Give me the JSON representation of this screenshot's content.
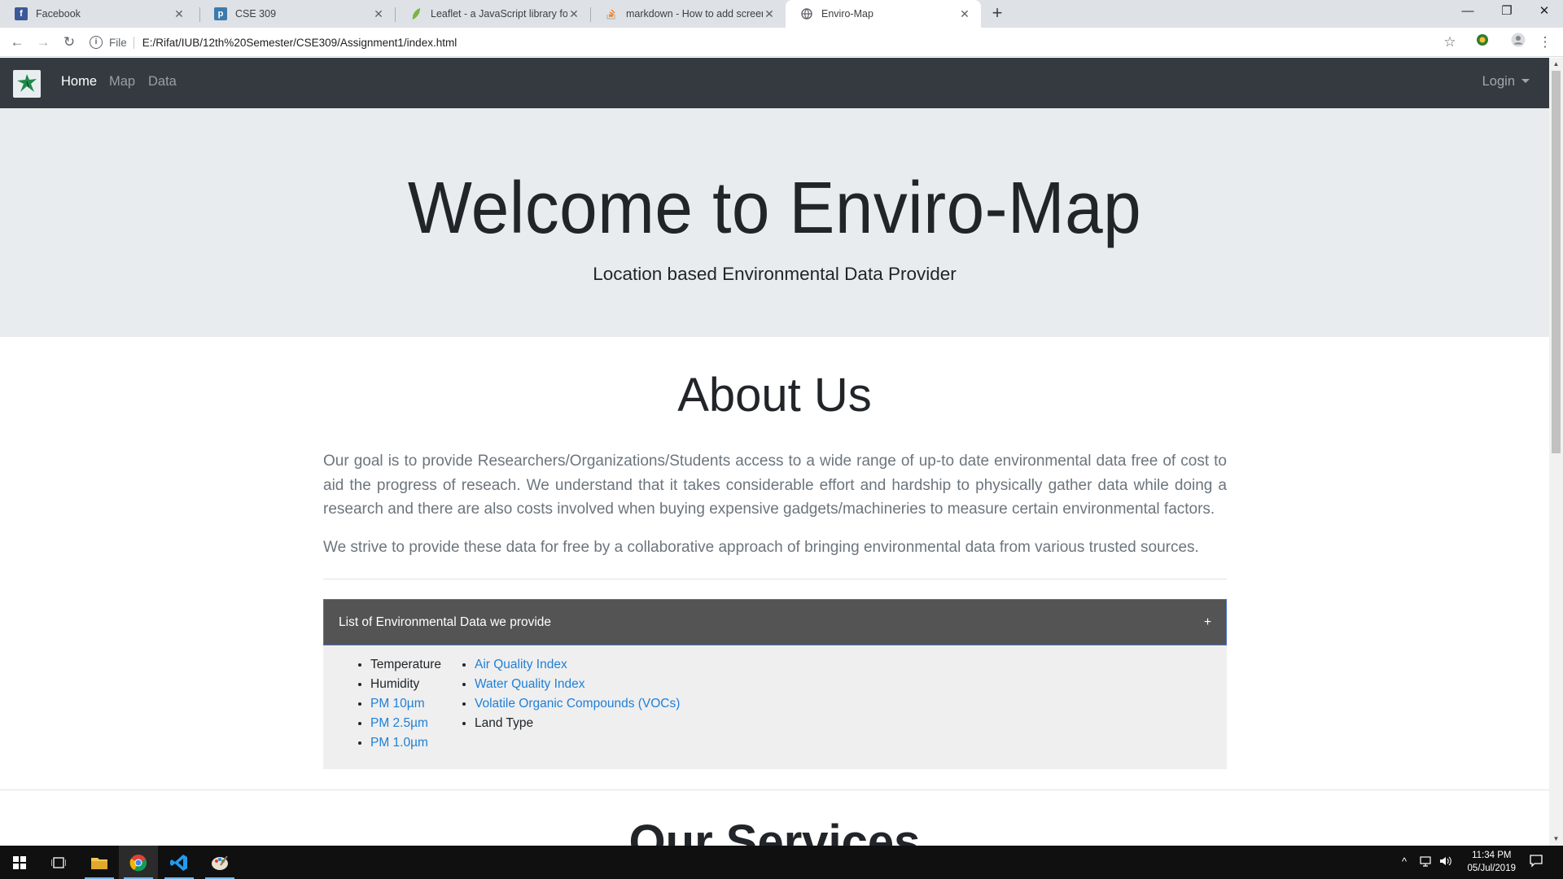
{
  "browser": {
    "tabs": [
      {
        "title": "Facebook",
        "icon": "facebook-icon",
        "active": false
      },
      {
        "title": "CSE 309",
        "icon": "piazza-icon",
        "active": false
      },
      {
        "title": "Leaflet - a JavaScript library for interactive maps",
        "icon": "leaflet-icon",
        "active": false
      },
      {
        "title": "markdown - How to add screenshots",
        "icon": "stackoverflow-icon",
        "active": false
      },
      {
        "title": "Enviro-Map",
        "icon": "globe-icon",
        "active": true
      }
    ],
    "address": {
      "scheme": "File",
      "url": "E:/Rifat/IUB/12th%20Semester/CSE309/Assignment1/index.html"
    }
  },
  "site": {
    "nav": {
      "links": [
        "Home",
        "Map",
        "Data"
      ],
      "active": "Home",
      "login": "Login"
    },
    "hero": {
      "title": "Welcome to Enviro-Map",
      "subtitle": "Location based Environmental Data Provider"
    },
    "about": {
      "title": "About Us",
      "paragraph1": "Our goal is to provide Researchers/Organizations/Students access to a wide range of up-to date environmental data free of cost to aid the progress of reseach. We understand that it takes considerable effort and hardship to physically gather data while doing a research and there are also costs involved when buying expensive gadgets/machineries to measure certain environmental factors.",
      "paragraph2": "We strive to provide these data for free by a collaborative approach of bringing environmental data from various trusted sources."
    },
    "accordion": {
      "header": "List of Environmental Data we provide",
      "toggle": "+",
      "list1": [
        {
          "text": "Temperature",
          "link": false
        },
        {
          "text": "Humidity",
          "link": false
        },
        {
          "text": "PM 10µm",
          "link": true
        },
        {
          "text": "PM 2.5µm",
          "link": true
        },
        {
          "text": "PM 1.0µm",
          "link": true
        }
      ],
      "list2": [
        {
          "text": "Air Quality Index",
          "link": true
        },
        {
          "text": "Water Quality Index",
          "link": true
        },
        {
          "text": "Volatile Organic Compounds (VOCs)",
          "link": true
        },
        {
          "text": "Land Type",
          "link": false
        }
      ]
    },
    "services": {
      "title": "Our Services"
    }
  },
  "taskbar": {
    "time": "11:34 PM",
    "date": "05/Jul/2019"
  },
  "colors": {
    "navbar": "#343a40",
    "jumbotron": "#e9ecef",
    "link": "#1f7fd6",
    "accordion_header": "#545454",
    "accordion_border": "#4a70c8"
  }
}
